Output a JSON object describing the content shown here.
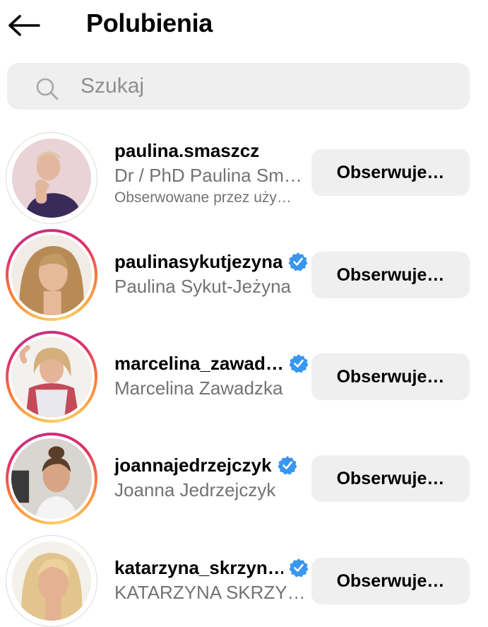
{
  "header": {
    "title": "Polubienia",
    "back_icon": "arrow-left-icon"
  },
  "search": {
    "placeholder": "Szukaj",
    "value": "",
    "icon": "search-icon"
  },
  "colors": {
    "accent_verified": "#3897f0",
    "button_bg": "#efefef",
    "secondary_text": "#737373"
  },
  "users": [
    {
      "username": "paulina.smaszcz",
      "full_name": "Dr / PhD Paulina Sm…",
      "subtext": "Obserwowane przez uży…",
      "verified": false,
      "story_ring": false,
      "button_label": "Obserwuje…"
    },
    {
      "username": "paulinasykutjezyna",
      "full_name": "Paulina Sykut-Jeżyna",
      "verified": true,
      "story_ring": true,
      "button_label": "Obserwuje…"
    },
    {
      "username": "marcelina_zawad…",
      "full_name": "Marcelina Zawadzka",
      "verified": true,
      "story_ring": true,
      "button_label": "Obserwuje…"
    },
    {
      "username": "joannajedrzejczyk",
      "full_name": "Joanna Jedrzejczyk",
      "verified": true,
      "story_ring": true,
      "button_label": "Obserwuje…"
    },
    {
      "username": "katarzyna_skrzyn…",
      "full_name": "KATARZYNA SKRZY…",
      "verified": true,
      "story_ring": false,
      "button_label": "Obserwuje…"
    }
  ]
}
